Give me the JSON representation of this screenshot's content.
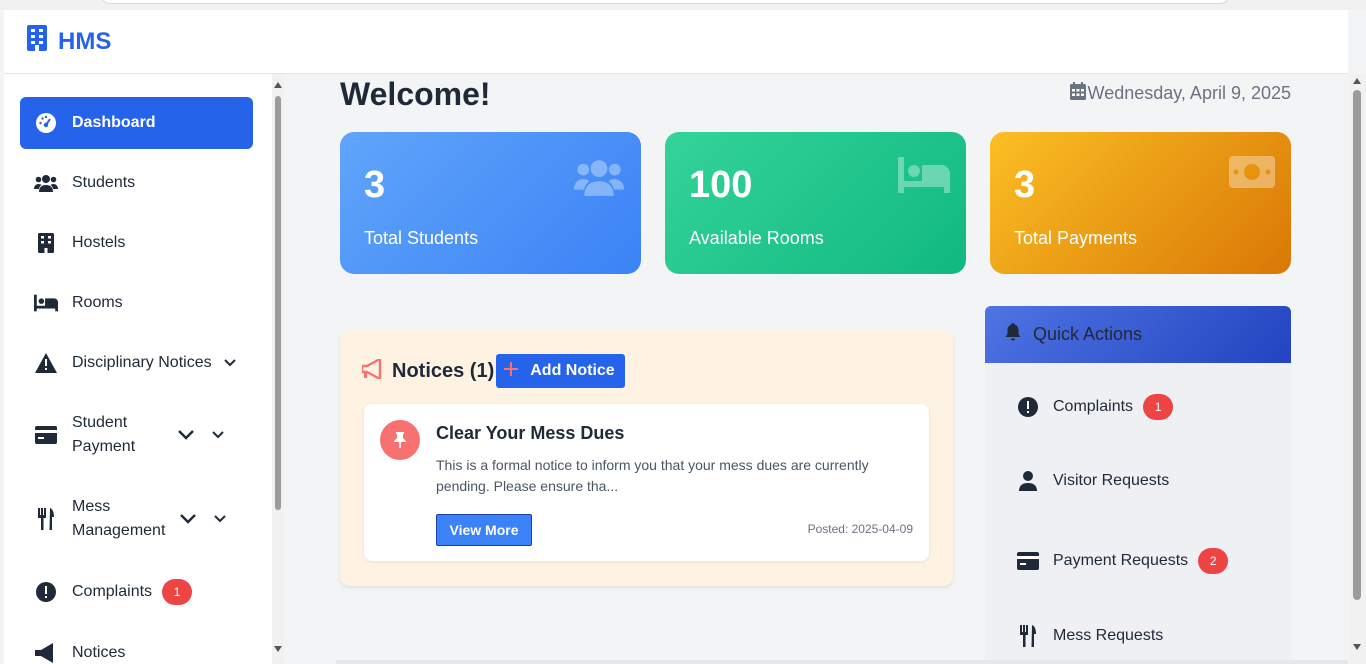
{
  "header": {
    "brand": "HMS",
    "brand_icon": "building-icon",
    "accent": "#2563eb"
  },
  "sidebar": {
    "items": [
      {
        "label": "Dashboard",
        "icon": "gauge-icon",
        "active": true
      },
      {
        "label": "Students",
        "icon": "users-icon"
      },
      {
        "label": "Hostels",
        "icon": "building-icon"
      },
      {
        "label": "Rooms",
        "icon": "bed-icon"
      },
      {
        "label": "Disciplinary Notices",
        "icon": "warning-icon"
      },
      {
        "label": "Student Payment",
        "icon": "credit-card-icon"
      },
      {
        "label": "Mess Management",
        "icon": "utensils-icon"
      },
      {
        "label": "Complaints",
        "icon": "exclamation-icon",
        "badge": "1"
      },
      {
        "label": "Notices",
        "icon": "megaphone-icon"
      }
    ]
  },
  "main": {
    "welcome": "Welcome!",
    "date": "Wednesday, April 9, 2025",
    "stats": [
      {
        "value": "3",
        "label": "Total Students",
        "icon": "users-icon",
        "color": "#3b82f6"
      },
      {
        "value": "100",
        "label": "Available Rooms",
        "icon": "bed-icon",
        "color": "#10b981"
      },
      {
        "value": "3",
        "label": "Total Payments",
        "icon": "money-bill-icon",
        "color": "#f59e0b"
      }
    ],
    "notices": {
      "title": "Notices (1)",
      "add_label": "Add Notice",
      "items": [
        {
          "title": "Clear Your Mess Dues",
          "body": "This is a formal notice to inform you that your mess dues are currently pending. Please ensure tha...",
          "button": "View More",
          "posted": "Posted: 2025-04-09"
        }
      ]
    },
    "quick_actions": {
      "title": "Quick Actions",
      "items": [
        {
          "label": "Complaints",
          "icon": "exclamation-icon",
          "badge": "1"
        },
        {
          "label": "Visitor Requests",
          "icon": "user-icon"
        },
        {
          "label": "Payment Requests",
          "icon": "credit-card-icon",
          "badge": "2"
        },
        {
          "label": "Mess Requests",
          "icon": "utensils-icon"
        }
      ]
    }
  }
}
